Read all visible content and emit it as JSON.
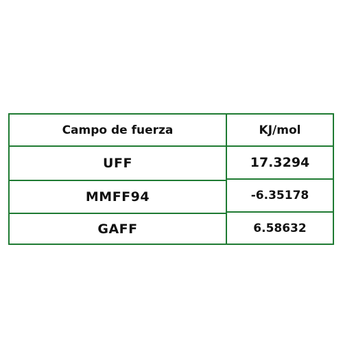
{
  "table": {
    "headers": [
      "Campo de fuerza",
      "KJ/mol"
    ],
    "rows": [
      [
        "UFF",
        "17.3294"
      ],
      [
        "MMFF94",
        "-6.35178"
      ],
      [
        "GAFF",
        "6.58632"
      ]
    ]
  },
  "colors": {
    "border": "#1e7a32",
    "text": "#111111",
    "background": "#ffffff"
  }
}
